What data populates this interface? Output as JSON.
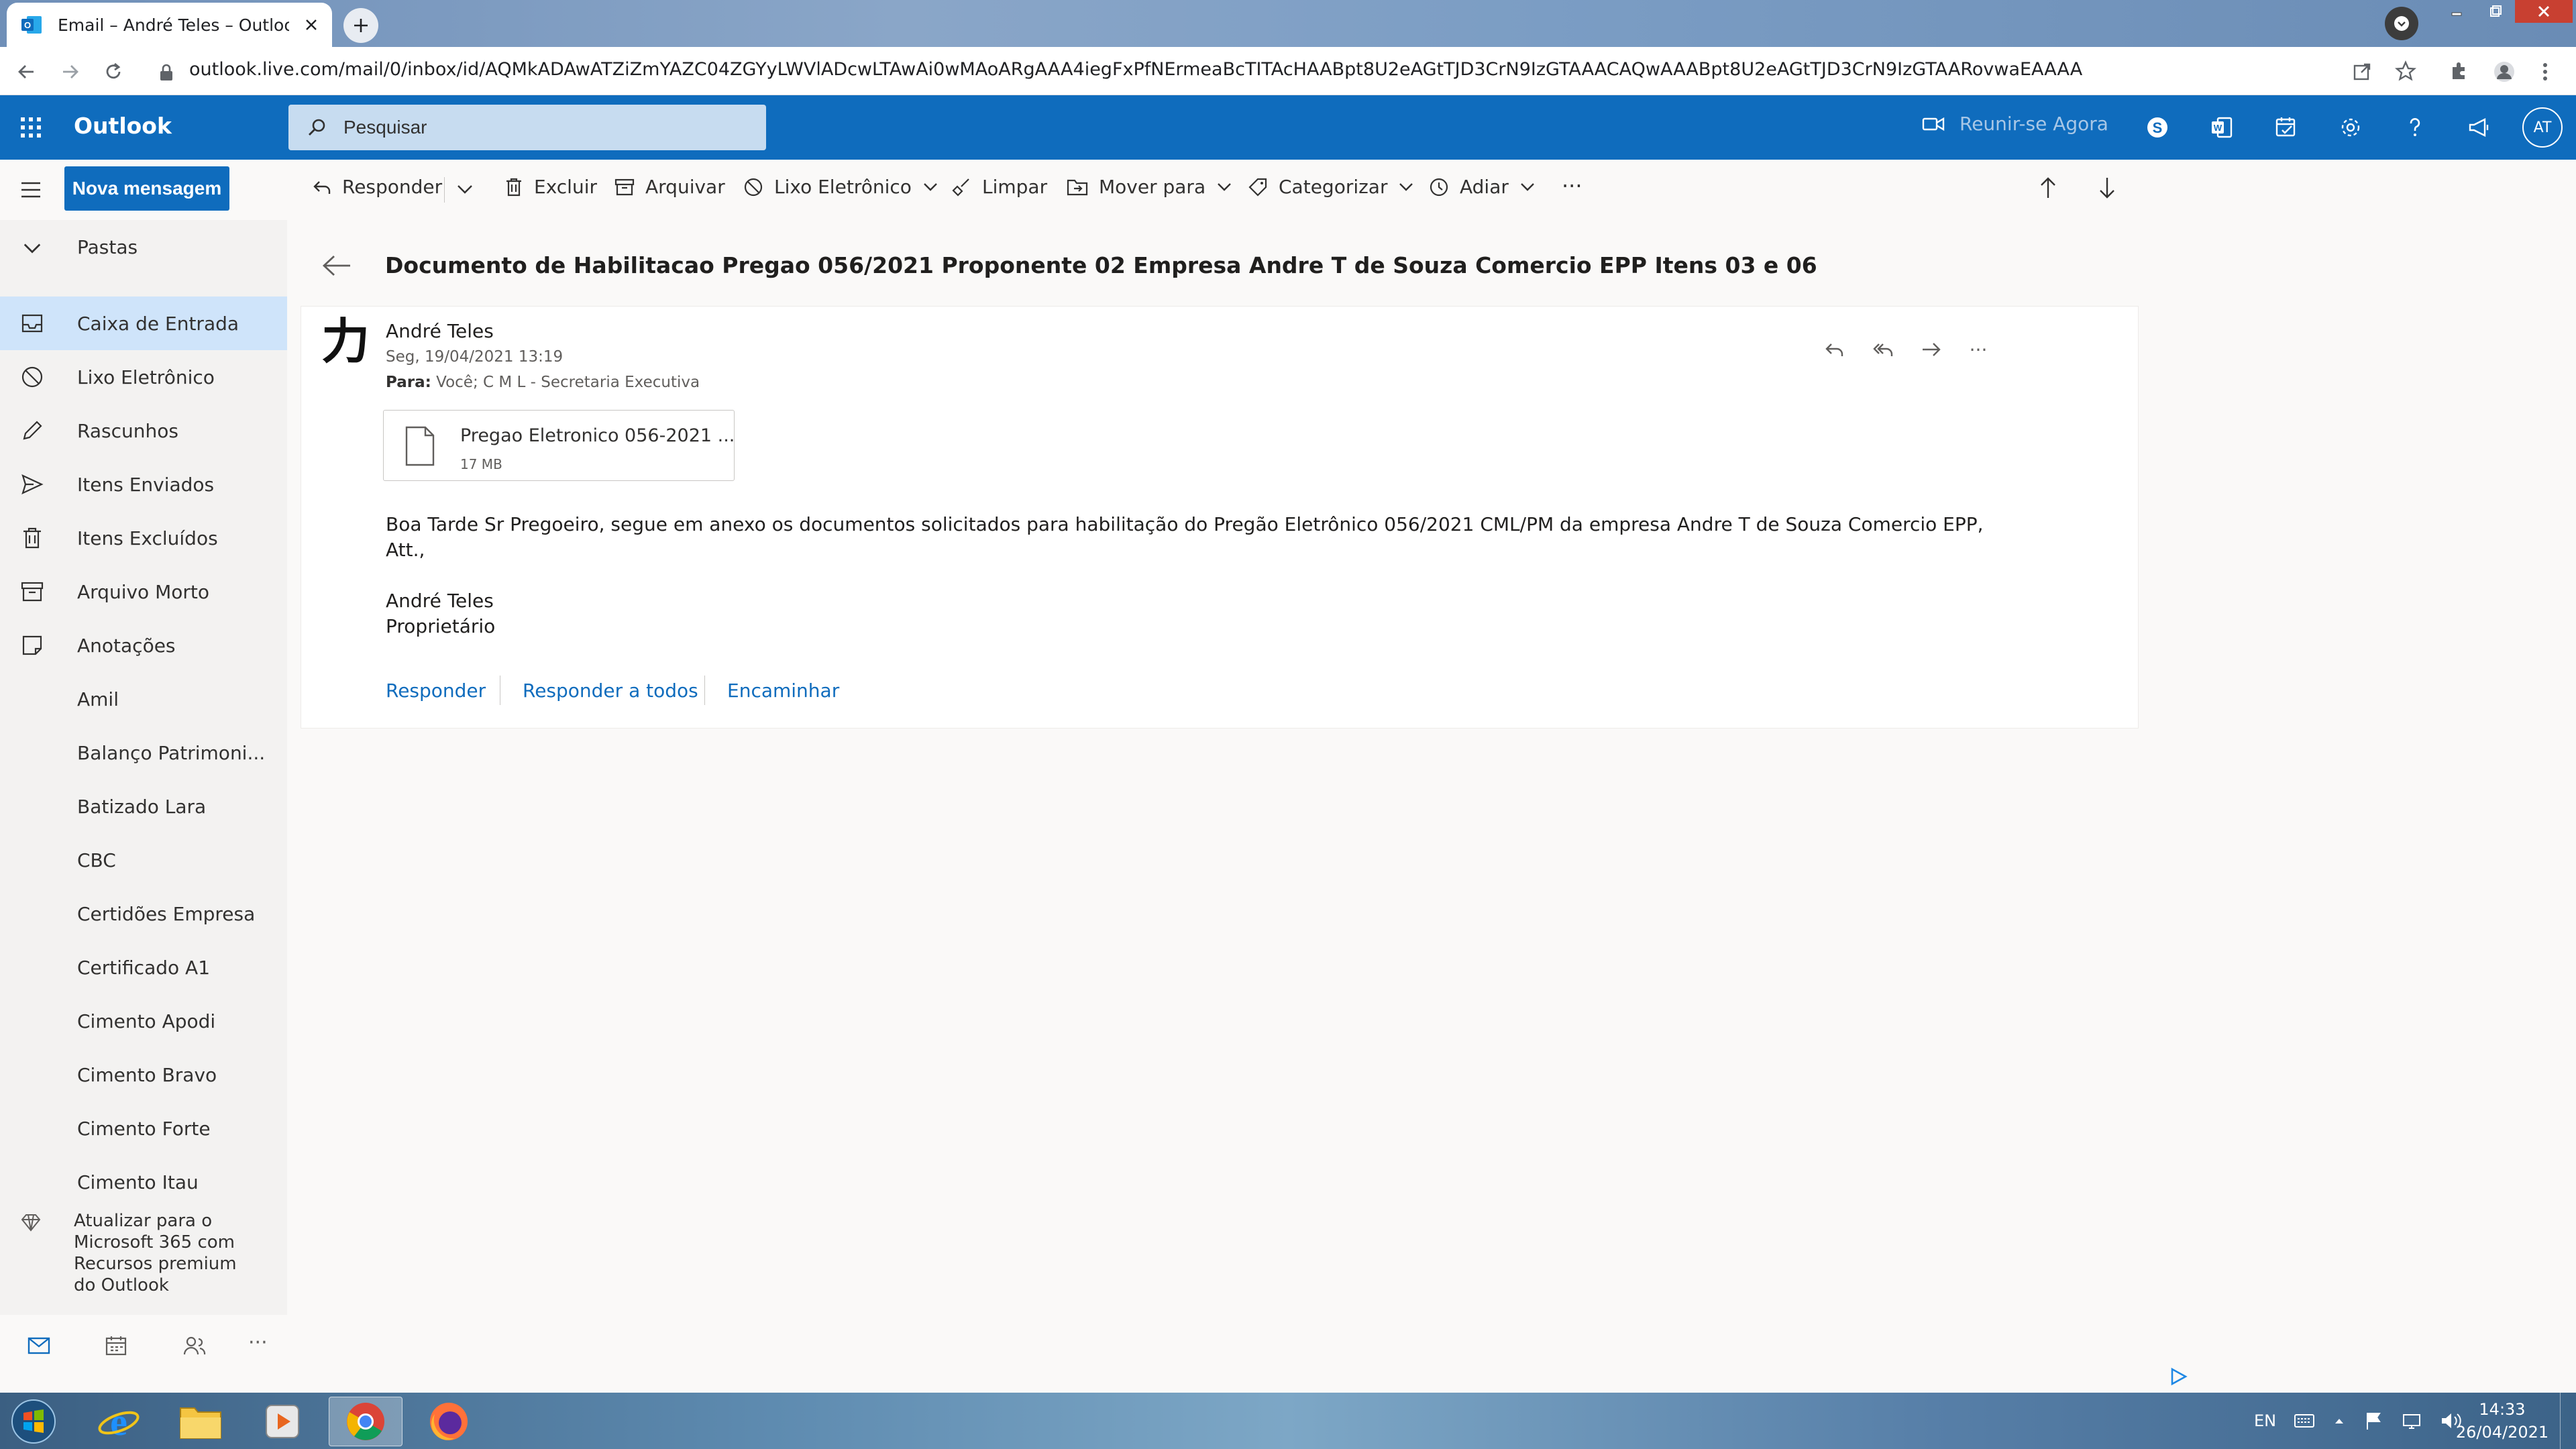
{
  "browser": {
    "tab_title": "Email – André Teles – Outlook",
    "url": "outlook.live.com/mail/0/inbox/id/AQMkADAwATZiZmYAZC04ZGYyLWVlADcwLTAwAi0wMAoARgAAA4iegFxPfNErmeaBcTITAcHAABpt8U2eAGtTJD3CrN9IzGTAAACAQwAAABpt8U2eAGtTJD3CrN9IzGTAARovwaEAAAA"
  },
  "header": {
    "app_name": "Outlook",
    "search_placeholder": "Pesquisar",
    "meet_now": "Reunir-se Agora",
    "avatar_initials": "AT"
  },
  "toolbar": {
    "new_message": "Nova mensagem",
    "reply": "Responder",
    "delete": "Excluir",
    "archive": "Arquivar",
    "junk": "Lixo Eletrônico",
    "sweep": "Limpar",
    "move_to": "Mover para",
    "categorize": "Categorizar",
    "snooze": "Adiar",
    "more": "···"
  },
  "sidebar": {
    "folders_label": "Pastas",
    "items": [
      {
        "label": "Caixa de Entrada",
        "icon": "inbox-icon",
        "selected": true
      },
      {
        "label": "Lixo Eletrônico",
        "icon": "junk-icon"
      },
      {
        "label": "Rascunhos",
        "icon": "pencil-icon"
      },
      {
        "label": "Itens Enviados",
        "icon": "send-icon"
      },
      {
        "label": "Itens Excluídos",
        "icon": "trash-icon"
      },
      {
        "label": "Arquivo Morto",
        "icon": "archive-icon"
      },
      {
        "label": "Anotações",
        "icon": "note-icon"
      },
      {
        "label": "Amil"
      },
      {
        "label": "Balanço Patrimoni..."
      },
      {
        "label": "Batizado Lara"
      },
      {
        "label": "CBC"
      },
      {
        "label": "Certidões Empresa"
      },
      {
        "label": "Certificado A1"
      },
      {
        "label": "Cimento Apodi"
      },
      {
        "label": "Cimento Bravo"
      },
      {
        "label": "Cimento Forte"
      },
      {
        "label": "Cimento Itau"
      }
    ],
    "upgrade_lines": [
      "Atualizar para o",
      "Microsoft 365 com",
      "Recursos premium",
      "do Outlook"
    ],
    "bottom_more": "···"
  },
  "message": {
    "subject": "Documento de Habilitacao Pregao 056/2021 Proponente 02 Empresa Andre T de Souza Comercio EPP Itens 03 e 06",
    "sender_glyph": "力",
    "sender": "André Teles",
    "date": "Seg, 19/04/2021 13:19",
    "to_label": "Para:",
    "to": "Você; C M L - Secretaria Executiva",
    "attachment_name": "Pregao Eletronico 056-2021 ...",
    "attachment_size": "17 MB",
    "body_line1": "Boa Tarde Sr Pregoeiro, segue em anexo os documentos solicitados para habilitação do Pregão Eletrônico 056/2021 CML/PM da empresa Andre T de Souza Comercio EPP,",
    "body_line2": "Att.,",
    "signature_name": "André Teles",
    "signature_title": "Proprietário",
    "quick_reply": "Responder",
    "quick_reply_all": "Responder a todos",
    "quick_forward": "Encaminhar",
    "more": "···"
  },
  "taskbar": {
    "language": "EN",
    "time": "14:33",
    "date": "26/04/2021"
  },
  "colors": {
    "brand_blue": "#0f6cbd",
    "selected_folder": "#cfe4fa",
    "link_blue": "#0f6cbd"
  }
}
